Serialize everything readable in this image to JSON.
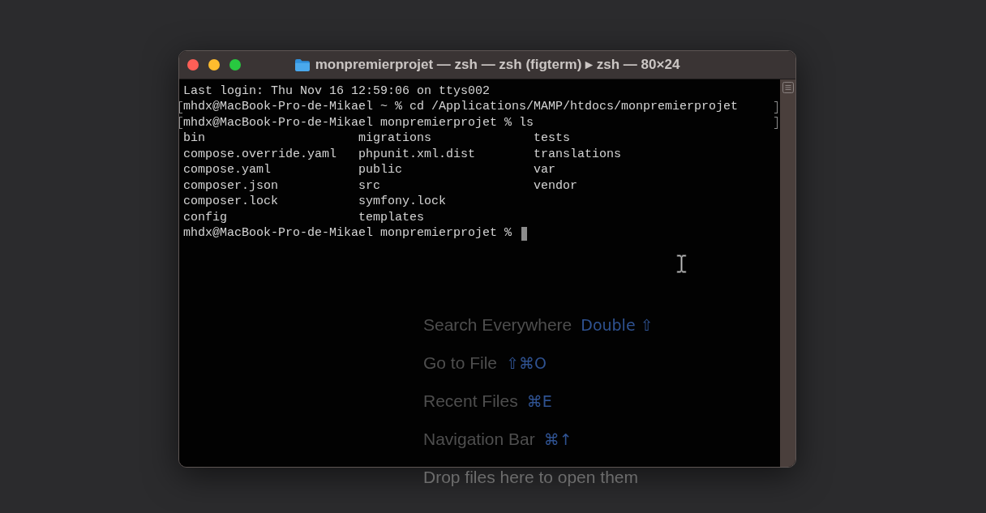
{
  "window": {
    "title": "monpremierprojet — zsh — zsh (figterm) ▸ zsh — 80×24"
  },
  "lines": [
    {
      "kind": "output",
      "text": "Last login: Thu Nov 16 12:59:06 on ttys002"
    },
    {
      "kind": "prompt",
      "text": "mhdx@MacBook-Pro-de-Mikael ~ % cd /Applications/MAMP/htdocs/monpremierprojet",
      "marked": true,
      "cursor": false
    },
    {
      "kind": "prompt",
      "text": "mhdx@MacBook-Pro-de-Mikael monpremierprojet % ls",
      "marked": true,
      "cursor": false
    },
    {
      "kind": "listing",
      "cells": [
        "bin",
        "migrations",
        "tests"
      ]
    },
    {
      "kind": "listing",
      "cells": [
        "compose.override.yaml",
        "phpunit.xml.dist",
        "translations"
      ]
    },
    {
      "kind": "listing",
      "cells": [
        "compose.yaml",
        "public",
        "var"
      ]
    },
    {
      "kind": "listing",
      "cells": [
        "composer.json",
        "src",
        "vendor"
      ]
    },
    {
      "kind": "listing",
      "cells": [
        "composer.lock",
        "symfony.lock"
      ]
    },
    {
      "kind": "listing",
      "cells": [
        "config",
        "templates"
      ]
    },
    {
      "kind": "prompt",
      "text": "mhdx@MacBook-Pro-de-Mikael monpremierprojet %",
      "marked": false,
      "cursor": true
    }
  ],
  "welcome_hints": [
    {
      "label": "Search Everywhere",
      "shortcut": "Double ⇧"
    },
    {
      "label": "Go to File",
      "shortcut": "⇧⌘O"
    },
    {
      "label": "Recent Files",
      "shortcut": "⌘E"
    },
    {
      "label": "Navigation Bar",
      "shortcut": "⌘↑"
    }
  ],
  "drop_hint": "Drop files here to open them"
}
